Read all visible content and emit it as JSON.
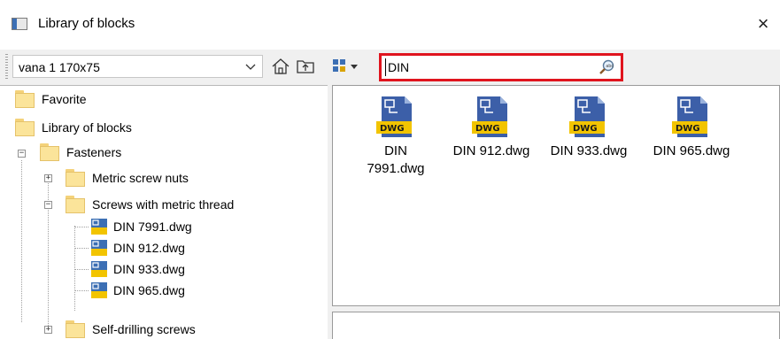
{
  "window": {
    "title": "Library of blocks",
    "close_glyph": "×"
  },
  "toolbar": {
    "combo_value": "vana 1 170x75",
    "search_value": "DIN",
    "icons": [
      "chevron-down-icon",
      "home-icon",
      "folder-up-icon",
      "view-mode-icon",
      "search-icon"
    ]
  },
  "tree": {
    "items": [
      {
        "label": "Favorite"
      },
      {
        "label": "Library of blocks"
      },
      {
        "label": "Fasteners"
      },
      {
        "label": "Metric screw nuts"
      },
      {
        "label": "Screws with metric thread"
      },
      {
        "label": "DIN 7991.dwg"
      },
      {
        "label": "DIN 912.dwg"
      },
      {
        "label": "DIN 933.dwg"
      },
      {
        "label": "DIN 965.dwg"
      },
      {
        "label": "Self-drilling screws"
      }
    ]
  },
  "files": {
    "badge": "DWG",
    "items": [
      {
        "line1": "DIN",
        "line2": "7991.dwg"
      },
      {
        "line1": "DIN 912.dwg",
        "line2": ""
      },
      {
        "line1": "DIN 933.dwg",
        "line2": ""
      },
      {
        "line1": "DIN 965.dwg",
        "line2": ""
      }
    ]
  },
  "colors": {
    "highlight_border": "#e0141e",
    "dwg_badge": "#f2c400",
    "dwg_body": "#3c5fa8"
  }
}
